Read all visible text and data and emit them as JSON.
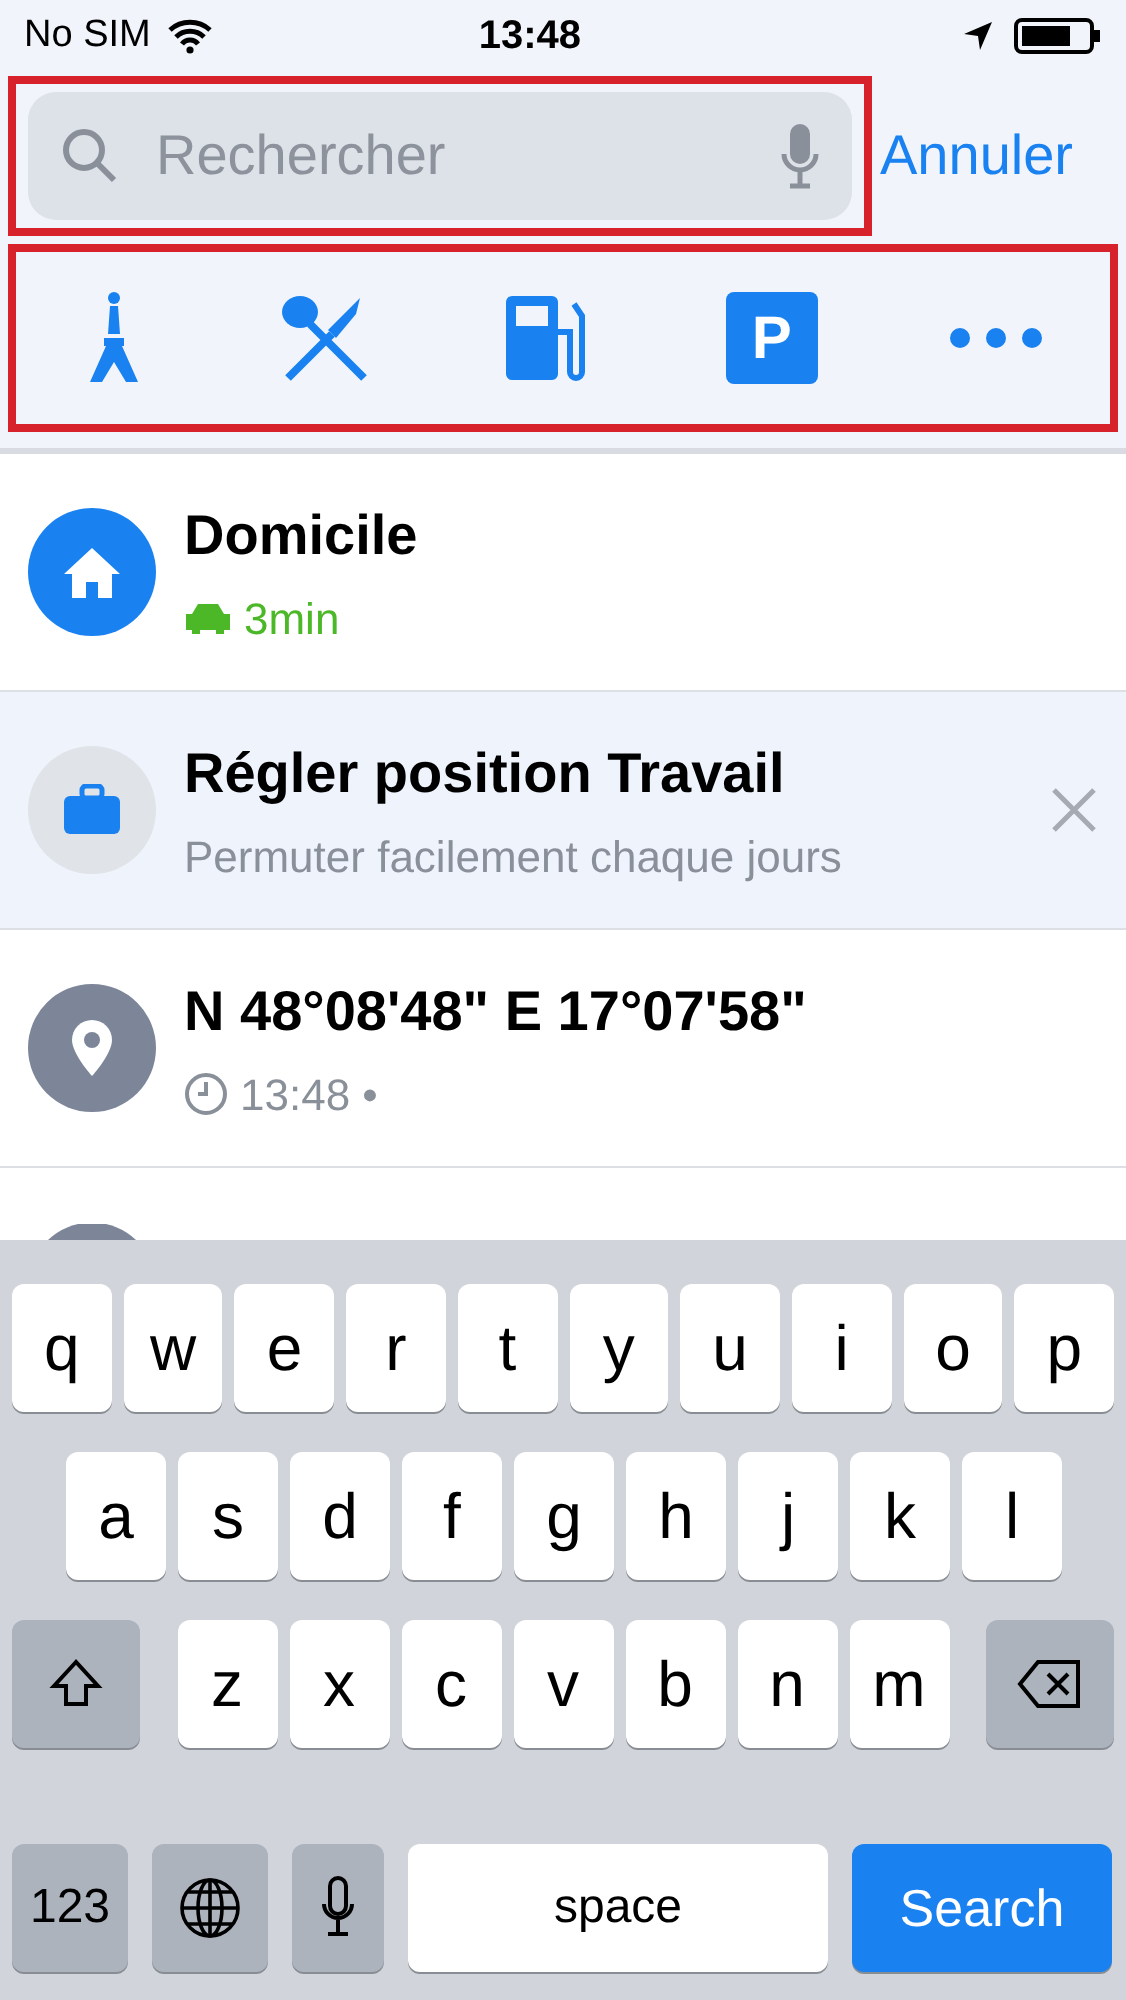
{
  "status_bar": {
    "carrier": "No SIM",
    "time": "13:48"
  },
  "search": {
    "placeholder": "Rechercher",
    "highlighted": true
  },
  "cancel": "Annuler",
  "categories": {
    "highlighted": true,
    "items": [
      {
        "kind": "sights"
      },
      {
        "kind": "food"
      },
      {
        "kind": "fuel"
      },
      {
        "kind": "parking",
        "label": "P"
      },
      {
        "kind": "more"
      }
    ]
  },
  "places": [
    {
      "kind": "home",
      "title": "Domicile",
      "detail": "3min",
      "selected": false
    },
    {
      "kind": "work",
      "title": "Régler position Travail",
      "detail": "Permuter facilement chaque jours",
      "selected": true,
      "dismissible": true
    },
    {
      "kind": "pin",
      "title": "N 48°08'48\" E 17°07'58\"",
      "detail": "13:48 •",
      "selected": false
    },
    {
      "kind": "pin",
      "selected": false
    }
  ],
  "keyboard": {
    "rows": [
      [
        "q",
        "w",
        "e",
        "r",
        "t",
        "y",
        "u",
        "i",
        "o",
        "p"
      ],
      [
        "a",
        "s",
        "d",
        "f",
        "g",
        "h",
        "j",
        "k",
        "l"
      ],
      [
        "z",
        "x",
        "c",
        "v",
        "b",
        "n",
        "m"
      ]
    ],
    "numbers": "123",
    "space": "space",
    "action": "Search"
  }
}
